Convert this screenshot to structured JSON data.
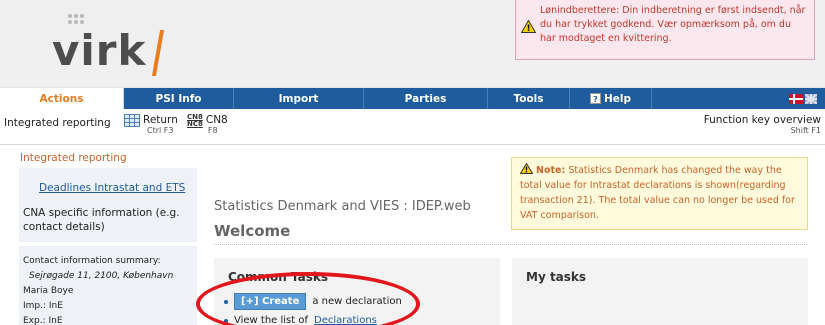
{
  "header": {
    "logo_text": "virk",
    "warning": "Lønindberettere: Din indberetning er først indsendt, når du har trykket godkend. Vær opmærksom på, om du har modtaget en kvittering."
  },
  "nav": {
    "tabs": [
      {
        "label": "Actions",
        "active": true
      },
      {
        "label": "PSI Info"
      },
      {
        "label": "Import"
      },
      {
        "label": "Parties"
      },
      {
        "label": "Tools"
      },
      {
        "label": "Help"
      }
    ]
  },
  "toolbar": {
    "integrated": "Integrated reporting",
    "return_label": "Return",
    "return_shortcut": "Ctrl F3",
    "cn8_label": "CN8",
    "cn8_shortcut": "F8",
    "fkey_label": "Function key overview",
    "fkey_shortcut": "Shift F1"
  },
  "left": {
    "title": "Integrated reporting",
    "deadlines_link": "Deadlines Intrastat and ETS",
    "cna_text": "CNA specific information (e.g. contact details)",
    "contact_title": "Contact information summary:",
    "address": "Sejrøgade 11, 2100, København",
    "name": "Maria Boye",
    "imp": "Imp.: InE",
    "exp": "Exp.: InE"
  },
  "main": {
    "subtitle": "Statistics Denmark and VIES : IDEP.web",
    "title": "Welcome",
    "note_label": "Note:",
    "note_text": "Statistics Denmark has changed the way the total value for Intrastat declarations is shown(regarding transaction 21). The total value can no longer be used for VAT comparison.",
    "common_tasks": "Common Tasks",
    "create_btn": "[+] Create",
    "create_suffix": "a new declaration",
    "view_prefix": "View the list of",
    "view_link": "Declarations",
    "my_tasks": "My tasks"
  },
  "colors": {
    "nav_blue": "#1f5c9e",
    "accent_orange": "#e87c1e",
    "highlight_red": "#e3161c"
  }
}
